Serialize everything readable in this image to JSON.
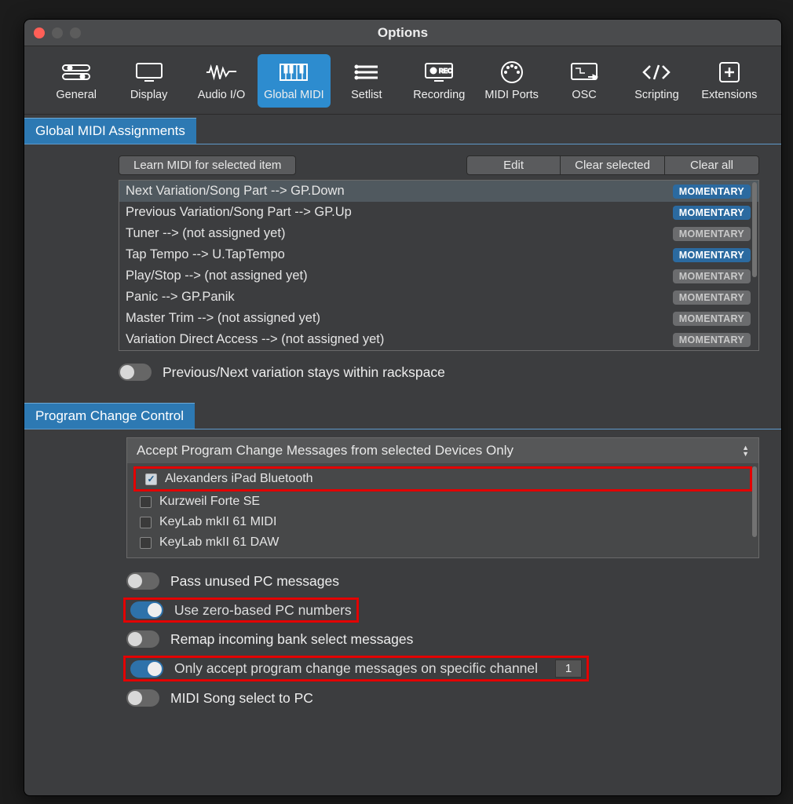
{
  "window": {
    "title": "Options"
  },
  "tabs": [
    {
      "label": "General"
    },
    {
      "label": "Display"
    },
    {
      "label": "Audio I/O"
    },
    {
      "label": "Global MIDI"
    },
    {
      "label": "Setlist"
    },
    {
      "label": "Recording"
    },
    {
      "label": "MIDI Ports"
    },
    {
      "label": "OSC"
    },
    {
      "label": "Scripting"
    },
    {
      "label": "Extensions"
    }
  ],
  "sections": {
    "gma": "Global MIDI Assignments",
    "pcc": "Program Change Control"
  },
  "buttons": {
    "learn": "Learn MIDI for selected item",
    "edit": "Edit",
    "clear_sel": "Clear selected",
    "clear_all": "Clear all"
  },
  "assignments": [
    {
      "label": "Next Variation/Song Part --> GP.Down",
      "badge": "MOMENTARY",
      "active": true,
      "sel": true
    },
    {
      "label": "Previous Variation/Song Part --> GP.Up",
      "badge": "MOMENTARY",
      "active": true,
      "sel": false
    },
    {
      "label": "Tuner --> (not assigned yet)",
      "badge": "MOMENTARY",
      "active": false,
      "sel": false
    },
    {
      "label": "Tap Tempo --> U.TapTempo",
      "badge": "MOMENTARY",
      "active": true,
      "sel": false
    },
    {
      "label": "Play/Stop --> (not assigned yet)",
      "badge": "MOMENTARY",
      "active": false,
      "sel": false
    },
    {
      "label": "Panic --> GP.Panik",
      "badge": "MOMENTARY",
      "active": false,
      "sel": false
    },
    {
      "label": "Master Trim --> (not assigned yet)",
      "badge": "MOMENTARY",
      "active": false,
      "sel": false
    },
    {
      "label": "Variation Direct Access --> (not assigned yet)",
      "badge": "MOMENTARY",
      "active": false,
      "sel": false
    }
  ],
  "toggles": {
    "stay_within": {
      "label": "Previous/Next variation stays within rackspace",
      "on": false
    },
    "pass_unused": {
      "label": "Pass unused PC messages",
      "on": false
    },
    "zero_based": {
      "label": "Use zero-based PC numbers",
      "on": true
    },
    "remap_bank": {
      "label": "Remap incoming bank select messages",
      "on": false
    },
    "only_channel": {
      "label": "Only accept program change messages on specific channel",
      "on": true,
      "value": "1"
    },
    "midi_song": {
      "label": "MIDI Song select to PC",
      "on": false
    }
  },
  "pc_source": {
    "header": "Accept Program Change Messages from selected Devices Only",
    "devices": [
      {
        "name": "Alexanders iPad Bluetooth",
        "checked": true
      },
      {
        "name": "Kurzweil Forte SE",
        "checked": false
      },
      {
        "name": "KeyLab mkII 61 MIDI",
        "checked": false
      },
      {
        "name": "KeyLab mkII 61 DAW",
        "checked": false
      }
    ]
  }
}
